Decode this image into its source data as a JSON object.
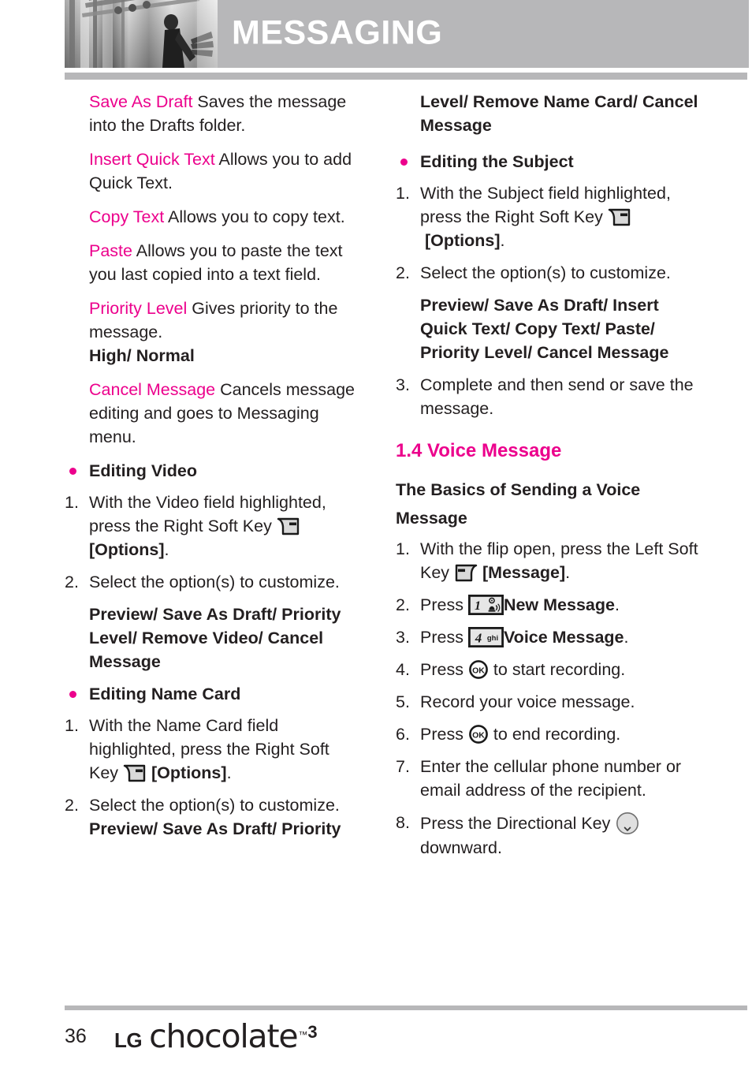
{
  "header": {
    "title": "MESSAGING",
    "photo_alt": "grayscale-photo"
  },
  "colors": {
    "accent": "#ec008c",
    "header_band": "#b7b7b9",
    "text": "#231f20"
  },
  "left_column": {
    "definitions": [
      {
        "term": "Save As Draft",
        "desc": " Saves the message into the Drafts folder."
      },
      {
        "term": "Insert Quick Text",
        "desc": " Allows you to add Quick Text."
      },
      {
        "term": "Copy Text",
        "desc": " Allows you to copy text."
      },
      {
        "term": "Paste",
        "desc": " Allows you to paste the text you last copied into a text field."
      },
      {
        "term": "Priority Level",
        "desc": " Gives priority to the message.",
        "bold_tail": "High/ Normal"
      },
      {
        "term": "Cancel Message",
        "desc": " Cancels message editing and goes to Messaging menu."
      }
    ],
    "editing_video": {
      "heading": "Editing Video",
      "step1_num": "1.",
      "step1_a": "With the Video field highlighted, press the Right Soft Key ",
      "step1_icon": "right-soft-key-icon",
      "step1_b": "[Options]",
      "step1_c": ".",
      "step2_num": "2.",
      "step2": "Select the option(s) to customize.",
      "options": "Preview/ Save As Draft/ Priority Level/ Remove Video/ Cancel Message"
    },
    "editing_name_card": {
      "heading": "Editing Name Card",
      "step1_num": "1.",
      "step1_a": "With the Name Card field highlighted, press the Right Soft Key ",
      "step1_icon": "right-soft-key-icon",
      "step1_b": "[Options]",
      "step1_c": ".",
      "step2_num": "2.",
      "step2": "Select the option(s) to customize.",
      "options_partial": "Preview/ Save As Draft/ Priority"
    }
  },
  "right_column": {
    "options_continued": "Level/ Remove Name Card/ Cancel Message",
    "editing_subject": {
      "heading": "Editing the Subject",
      "step1_num": "1.",
      "step1_a": "With the Subject field highlighted, press the Right Soft Key ",
      "step1_icon": "right-soft-key-icon",
      "step1_b": "[Options]",
      "step1_c": ".",
      "step2_num": "2.",
      "step2": "Select the option(s) to customize.",
      "options": "Preview/ Save As Draft/ Insert Quick Text/ Copy Text/ Paste/ Priority Level/ Cancel Message",
      "step3_num": "3.",
      "step3": "Complete and then send or save the message."
    },
    "section": {
      "title": "1.4 Voice Message",
      "subtitle": "The Basics of Sending a Voice Message",
      "steps": [
        {
          "num": "1.",
          "text_a": "With the flip open, press the Left Soft Key ",
          "icon": "left-soft-key-icon",
          "text_b": "[Message]",
          "text_c": "."
        },
        {
          "num": "2.",
          "text_a": "Press ",
          "icon": "key-1-voicemail-icon",
          "icon_label": "1",
          "text_b": "New Message",
          "text_c": "."
        },
        {
          "num": "3.",
          "text_a": "Press ",
          "icon": "key-4-ghi-icon",
          "icon_label": "4",
          "icon_sub": "ghi",
          "text_b": "Voice Message",
          "text_c": "."
        },
        {
          "num": "4.",
          "text_a": "Press ",
          "icon": "ok-key-icon",
          "text_b": "",
          "text_c": " to start recording."
        },
        {
          "num": "5.",
          "text_a": "Record your voice message.",
          "icon": "",
          "text_b": "",
          "text_c": ""
        },
        {
          "num": "6.",
          "text_a": "Press ",
          "icon": "ok-key-icon",
          "text_b": "",
          "text_c": " to end recording."
        },
        {
          "num": "7.",
          "text_a": "Enter the cellular phone number or email address of the recipient.",
          "icon": "",
          "text_b": "",
          "text_c": ""
        },
        {
          "num": "8.",
          "text_a": "Press the Directional Key ",
          "icon": "directional-key-down-icon",
          "text_b": "",
          "text_c": " downward."
        }
      ]
    }
  },
  "footer": {
    "page_number": "36",
    "logo_lg": "LG",
    "logo_word": "chocolate",
    "logo_tm": "™",
    "logo_version": "3"
  }
}
